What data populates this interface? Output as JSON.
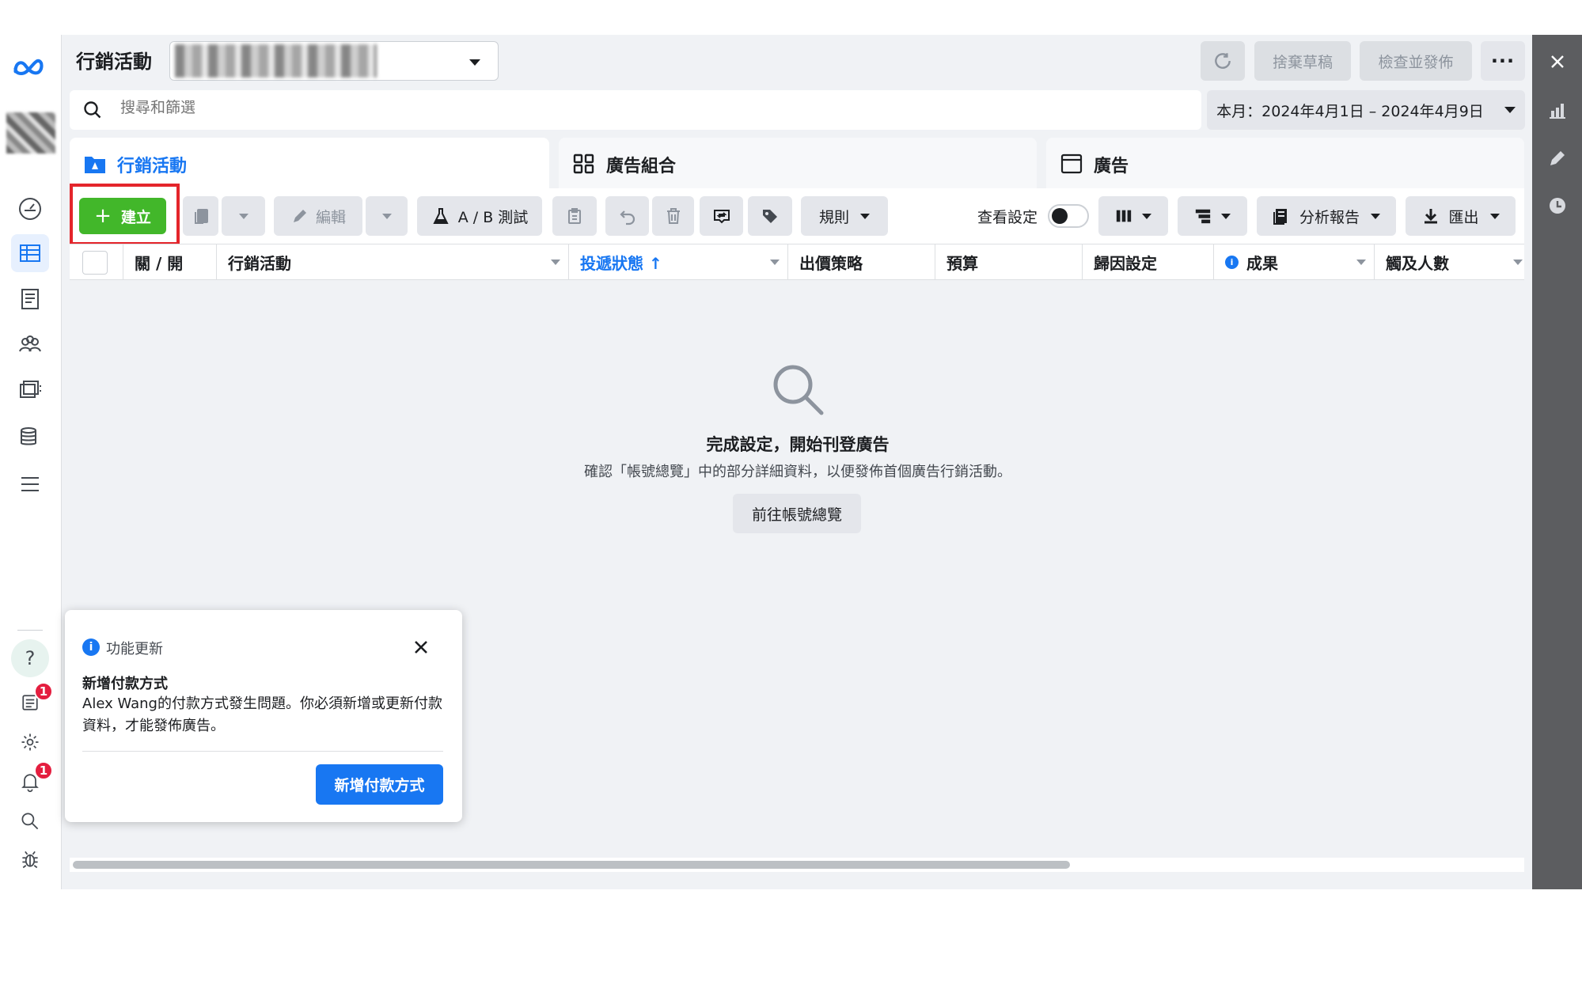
{
  "header": {
    "title": "行銷活動",
    "discard_label": "捨棄草稿",
    "publish_label": "檢查並發佈",
    "more_label": "···"
  },
  "search": {
    "placeholder": "搜尋和篩選",
    "date_range": "本月：2024年4月1日 – 2024年4月9日"
  },
  "tabs": [
    {
      "label": "行銷活動"
    },
    {
      "label": "廣告組合"
    },
    {
      "label": "廣告"
    }
  ],
  "toolbar": {
    "create_label": "建立",
    "edit_label": "編輯",
    "ab_test_label": "A / B 測試",
    "rules_label": "規則",
    "view_settings_label": "查看設定",
    "reports_label": "分析報告",
    "export_label": "匯出"
  },
  "table": {
    "columns": [
      "關 / 開",
      "行銷活動",
      "投遞狀態 ↑",
      "出價策略",
      "預算",
      "歸因設定",
      "成果",
      "觸及人數"
    ]
  },
  "empty_state": {
    "title": "完成設定，開始刊登廣告",
    "description": "確認「帳號總覽」中的部分詳細資料，以便發佈首個廣告行銷活動。",
    "button_label": "前往帳號總覽"
  },
  "notice": {
    "kicker": "功能更新",
    "heading": "新增付款方式",
    "body": "Alex Wang的付款方式發生問題。你必須新增或更新付款資料，才能發佈廣告。",
    "action_label": "新增付款方式"
  },
  "nav": {
    "help_label": "?",
    "news_badge": "1",
    "notification_badge": "1"
  },
  "colors": {
    "accent": "#1877f2",
    "create_green": "#42b72a",
    "highlight_red": "#e4252b"
  }
}
